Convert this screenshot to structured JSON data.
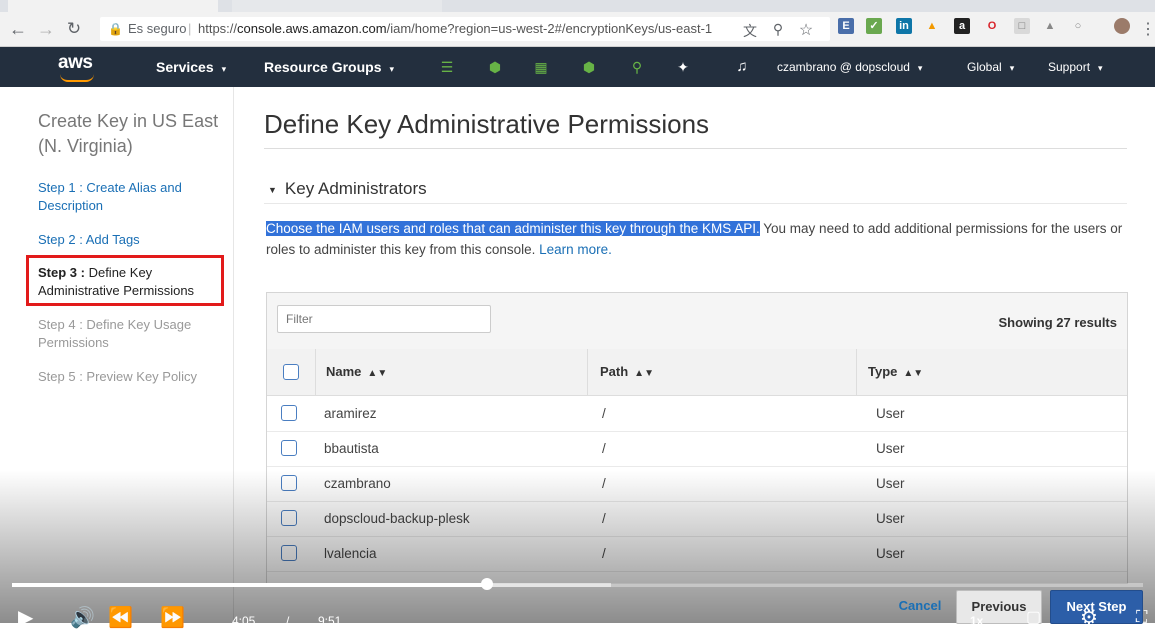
{
  "browser": {
    "secure_label": "Es seguro",
    "url_prefix": "https://",
    "url_host": "console.aws.amazon.com",
    "url_path": "/iam/home?region=us-west-2#/encryptionKeys/us-east-1"
  },
  "header": {
    "logo": "aws",
    "services": "Services",
    "resource_groups": "Resource Groups",
    "account": "czambrano @ dopscloud",
    "region": "Global",
    "support": "Support"
  },
  "wizard": {
    "title": "Create Key in US East (N. Virginia)",
    "steps": [
      {
        "label": "Step 1 : Create Alias and Description"
      },
      {
        "label": "Step 2 : Add Tags"
      },
      {
        "prefix": "Step 3 :",
        "label": " Define Key Administrative Permissions"
      },
      {
        "label": "Step 4 : Define Key Usage Permissions"
      },
      {
        "label": "Step 5 : Preview Key Policy"
      }
    ]
  },
  "main": {
    "title": "Define Key Administrative Permissions",
    "section": "Key Administrators",
    "desc_highlight": "Choose the IAM users and roles that can administer this key through the KMS API.",
    "desc_rest": " You may need to add additional permissions for the users or roles to administer this key from this console. ",
    "learn_more": "Learn more."
  },
  "table": {
    "filter_placeholder": "Filter",
    "count": "Showing 27 results",
    "columns": [
      "Name",
      "Path",
      "Type"
    ],
    "rows": [
      {
        "name": "aramirez",
        "path": "/",
        "type": "User"
      },
      {
        "name": "bbautista",
        "path": "/",
        "type": "User"
      },
      {
        "name": "czambrano",
        "path": "/",
        "type": "User"
      },
      {
        "name": "dopscloud-backup-plesk",
        "path": "/",
        "type": "User"
      },
      {
        "name": "lvalencia",
        "path": "/",
        "type": "User"
      }
    ]
  },
  "footer": {
    "cancel": "Cancel",
    "previous": "Previous",
    "next": "Next Step"
  },
  "video": {
    "current_time": "4:05",
    "separator": "/",
    "duration": "9:51",
    "played_fraction": 0.42,
    "buffered_fraction": 0.53,
    "speed": "1x"
  },
  "colors": {
    "aws_header": "#232f3e",
    "aws_orange": "#ff9900",
    "link": "#1a6fb5",
    "highlight": "#3272d9",
    "annotation_red": "#e21a1a",
    "primary_button": "#2c5ea8"
  }
}
